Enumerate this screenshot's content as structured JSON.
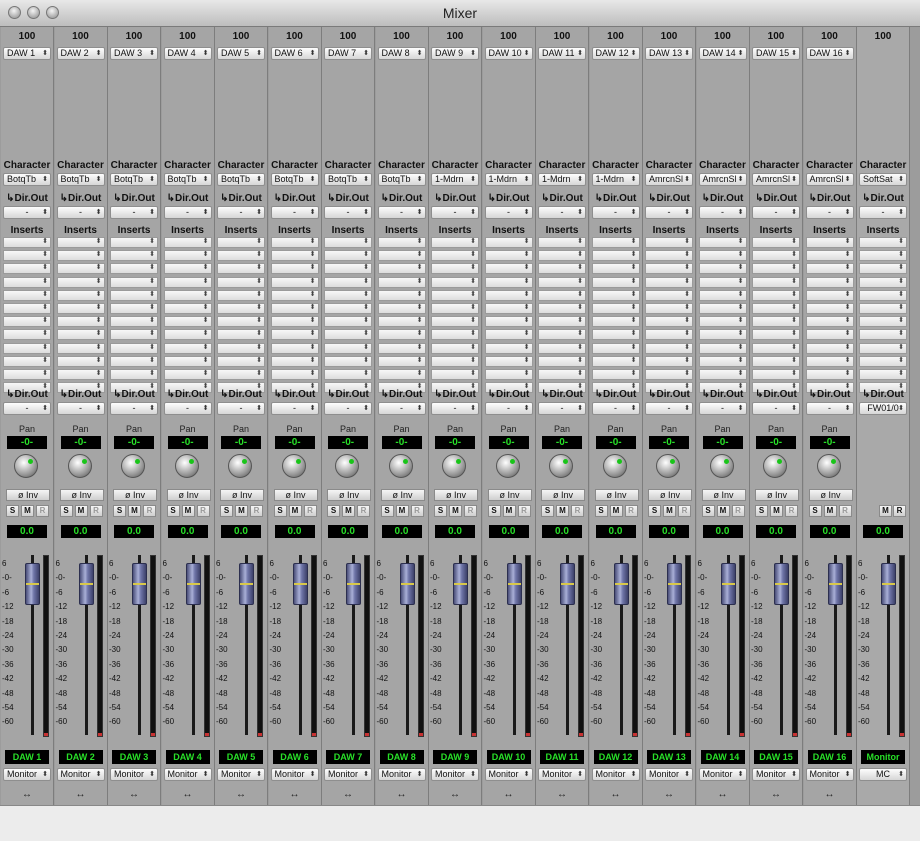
{
  "window": {
    "title": "Mixer"
  },
  "colors": {
    "display_bg": "#000000",
    "display_text": "#28e028",
    "fader_cap": "#6f75a8",
    "strip_bg": "#a5a5a5"
  },
  "labels": {
    "character": "Character",
    "dir_out": "↳Dir.Out",
    "inserts": "Inserts",
    "pan": "Pan",
    "invert": "ø Inv",
    "solo": "S",
    "mute": "M",
    "record": "R",
    "link": "↔"
  },
  "meter_scale": [
    "6",
    "-0-",
    "-6",
    "-12",
    "-18",
    "-24",
    "-30",
    "-36",
    "-42",
    "-48",
    "-54",
    "-60"
  ],
  "channels": [
    {
      "number": "100",
      "input": "DAW 1",
      "character": "BotqTb",
      "pre_out": "-",
      "post_out": "-",
      "pan": "-0-",
      "volume": "0.0",
      "name": "DAW 1",
      "destination": "Monitor"
    },
    {
      "number": "100",
      "input": "DAW 2",
      "character": "BotqTb",
      "pre_out": "-",
      "post_out": "-",
      "pan": "-0-",
      "volume": "0.0",
      "name": "DAW 2",
      "destination": "Monitor"
    },
    {
      "number": "100",
      "input": "DAW 3",
      "character": "BotqTb",
      "pre_out": "-",
      "post_out": "-",
      "pan": "-0-",
      "volume": "0.0",
      "name": "DAW 3",
      "destination": "Monitor"
    },
    {
      "number": "100",
      "input": "DAW 4",
      "character": "BotqTb",
      "pre_out": "-",
      "post_out": "-",
      "pan": "-0-",
      "volume": "0.0",
      "name": "DAW 4",
      "destination": "Monitor"
    },
    {
      "number": "100",
      "input": "DAW 5",
      "character": "BotqTb",
      "pre_out": "-",
      "post_out": "-",
      "pan": "-0-",
      "volume": "0.0",
      "name": "DAW 5",
      "destination": "Monitor"
    },
    {
      "number": "100",
      "input": "DAW 6",
      "character": "BotqTb",
      "pre_out": "-",
      "post_out": "-",
      "pan": "-0-",
      "volume": "0.0",
      "name": "DAW 6",
      "destination": "Monitor"
    },
    {
      "number": "100",
      "input": "DAW 7",
      "character": "BotqTb",
      "pre_out": "-",
      "post_out": "-",
      "pan": "-0-",
      "volume": "0.0",
      "name": "DAW 7",
      "destination": "Monitor"
    },
    {
      "number": "100",
      "input": "DAW 8",
      "character": "BotqTb",
      "pre_out": "-",
      "post_out": "-",
      "pan": "-0-",
      "volume": "0.0",
      "name": "DAW 8",
      "destination": "Monitor"
    },
    {
      "number": "100",
      "input": "DAW 9",
      "character": "1-Mdrn",
      "pre_out": "-",
      "post_out": "-",
      "pan": "-0-",
      "volume": "0.0",
      "name": "DAW 9",
      "destination": "Monitor"
    },
    {
      "number": "100",
      "input": "DAW 10",
      "character": "1-Mdrn",
      "pre_out": "-",
      "post_out": "-",
      "pan": "-0-",
      "volume": "0.0",
      "name": "DAW 10",
      "destination": "Monitor"
    },
    {
      "number": "100",
      "input": "DAW 11",
      "character": "1-Mdrn",
      "pre_out": "-",
      "post_out": "-",
      "pan": "-0-",
      "volume": "0.0",
      "name": "DAW 11",
      "destination": "Monitor"
    },
    {
      "number": "100",
      "input": "DAW 12",
      "character": "1-Mdrn",
      "pre_out": "-",
      "post_out": "-",
      "pan": "-0-",
      "volume": "0.0",
      "name": "DAW 12",
      "destination": "Monitor"
    },
    {
      "number": "100",
      "input": "DAW 13",
      "character": "AmrcnSl",
      "pre_out": "-",
      "post_out": "-",
      "pan": "-0-",
      "volume": "0.0",
      "name": "DAW 13",
      "destination": "Monitor"
    },
    {
      "number": "100",
      "input": "DAW 14",
      "character": "AmrcnSl",
      "pre_out": "-",
      "post_out": "-",
      "pan": "-0-",
      "volume": "0.0",
      "name": "DAW 14",
      "destination": "Monitor"
    },
    {
      "number": "100",
      "input": "DAW 15",
      "character": "AmrcnSl",
      "pre_out": "-",
      "post_out": "-",
      "pan": "-0-",
      "volume": "0.0",
      "name": "DAW 15",
      "destination": "Monitor"
    },
    {
      "number": "100",
      "input": "DAW 16",
      "character": "AmrcnSl",
      "pre_out": "-",
      "post_out": "-",
      "pan": "-0-",
      "volume": "0.0",
      "name": "DAW 16",
      "destination": "Monitor"
    }
  ],
  "monitor": {
    "number": "100",
    "character": "SoftSat",
    "pre_out": "-",
    "post_out": "FW01/0",
    "volume": "0.0",
    "name": "Monitor",
    "destination": "MC"
  }
}
